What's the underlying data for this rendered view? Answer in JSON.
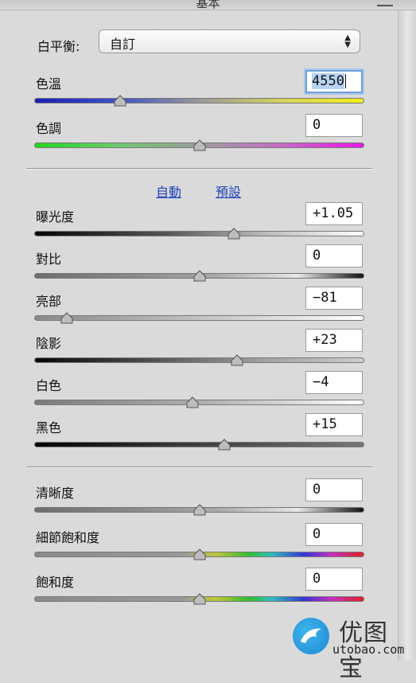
{
  "window": {
    "title": "基本"
  },
  "white_balance": {
    "label": "白平衡:",
    "selected": "自訂"
  },
  "temperature": {
    "label": "色溫",
    "value": "4550",
    "position": 0.26
  },
  "tint": {
    "label": "色調",
    "value": "0",
    "position": 0.5
  },
  "auto_default": {
    "auto_label": "自動",
    "default_label": "預設"
  },
  "tone": [
    {
      "label": "曝光度",
      "value": "+1.05",
      "position": 0.605
    },
    {
      "label": "對比",
      "value": "0",
      "position": 0.5
    },
    {
      "label": "亮部",
      "value": "−81",
      "position": 0.095
    },
    {
      "label": "陰影",
      "value": "+23",
      "position": 0.615
    },
    {
      "label": "白色",
      "value": "−4",
      "position": 0.48
    },
    {
      "label": "黑色",
      "value": "+15",
      "position": 0.575
    }
  ],
  "presence": [
    {
      "label": "清晰度",
      "value": "0",
      "position": 0.5
    },
    {
      "label": "細節飽和度",
      "value": "0",
      "position": 0.5
    },
    {
      "label": "飽和度",
      "value": "0",
      "position": 0.5
    }
  ],
  "watermark": {
    "title": "优图宝",
    "url": "utobao.com"
  }
}
